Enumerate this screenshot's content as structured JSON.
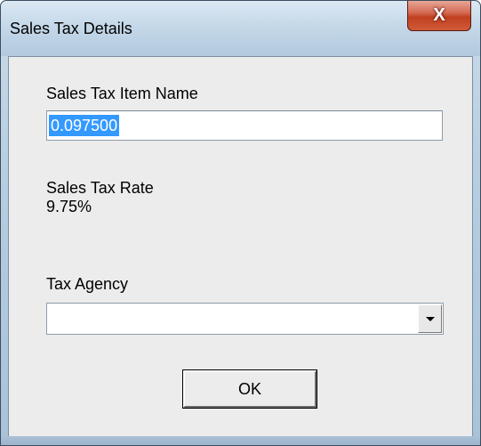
{
  "window": {
    "title": "Sales Tax Details",
    "close_glyph": "X"
  },
  "form": {
    "item_name_label": "Sales Tax Item Name",
    "item_name_value": "0.097500",
    "rate_label": "Sales Tax Rate",
    "rate_value": "9.75%",
    "agency_label": "Tax Agency",
    "agency_value": ""
  },
  "buttons": {
    "ok_label": "OK"
  },
  "icons": {
    "close": "close-icon",
    "dropdown": "chevron-down-icon"
  },
  "colors": {
    "selection": "#3399ff",
    "close_button": "#c1401f"
  }
}
